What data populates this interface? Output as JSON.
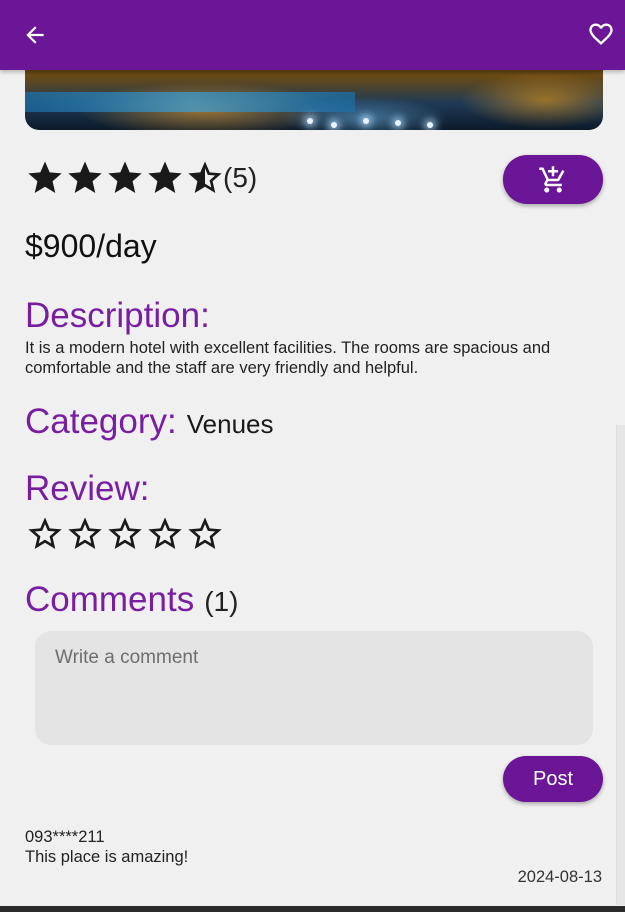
{
  "appbar": {
    "back_icon": "arrow-left-icon",
    "favorite_icon": "heart-outline-icon"
  },
  "hero": {
    "description": "hotel pool at night"
  },
  "rating": {
    "value": 4.5,
    "max": 5,
    "count_text": "(5)"
  },
  "cart_button": {
    "icon": "add-shopping-cart-icon"
  },
  "price": "$900/day",
  "description": {
    "title": "Description:",
    "text": "It is a modern hotel with excellent facilities. The rooms are spacious and comfortable and the staff are very friendly and helpful."
  },
  "category": {
    "title": "Category:",
    "value": "Venues"
  },
  "review": {
    "title": "Review:",
    "selected": 0,
    "max": 5
  },
  "comments": {
    "title": "Comments",
    "count_text": "(1)",
    "input_placeholder": "Write a comment",
    "post_label": "Post",
    "items": [
      {
        "user": "093****211",
        "text": "This place is amazing!",
        "date": "2024-08-13"
      }
    ]
  },
  "colors": {
    "primary": "#6a1696",
    "heading": "#7a1ea1",
    "background": "#f0f0f0"
  }
}
